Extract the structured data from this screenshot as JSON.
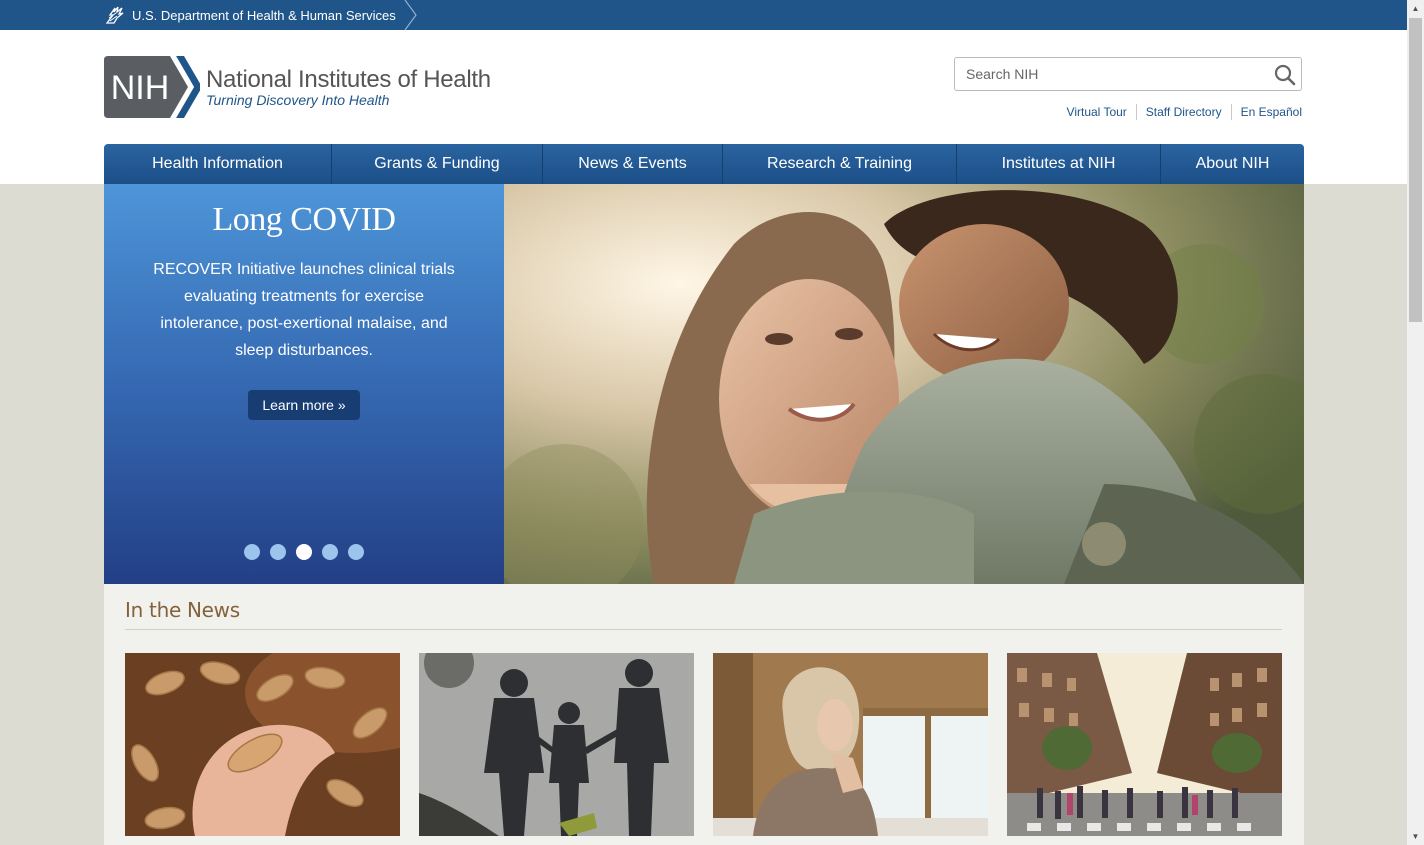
{
  "hhs_bar": {
    "label": "U.S. Department of Health & Human Services"
  },
  "logo": {
    "badge": "NIH",
    "title": "National Institutes of Health",
    "tagline": "Turning Discovery Into Health"
  },
  "search": {
    "placeholder": "Search NIH",
    "button_icon": "magnifier-icon"
  },
  "utility_links": [
    "Virtual Tour",
    "Staff Directory",
    "En Español"
  ],
  "nav": [
    "Health Information",
    "Grants & Funding",
    "News & Events",
    "Research & Training",
    "Institutes at NIH",
    "About NIH"
  ],
  "hero": {
    "title": "Long COVID",
    "text": "RECOVER Initiative launches clinical trials evaluating treatments for exercise intolerance, post-exertional malaise, and sleep disturbances.",
    "button": "Learn more »",
    "slide_count": 5,
    "active_slide": 3
  },
  "news": {
    "heading": "In the News",
    "items": [
      {
        "image": "peanuts-in-hand-photo"
      },
      {
        "image": "family-shadows-photo"
      },
      {
        "image": "woman-by-window-photo"
      },
      {
        "image": "city-street-crowd-photo"
      }
    ]
  },
  "colors": {
    "hhs_blue": "#20558a",
    "nav_blue": "#1c4f88",
    "news_heading": "#84633b",
    "page_bg": "#dcdcd3"
  }
}
